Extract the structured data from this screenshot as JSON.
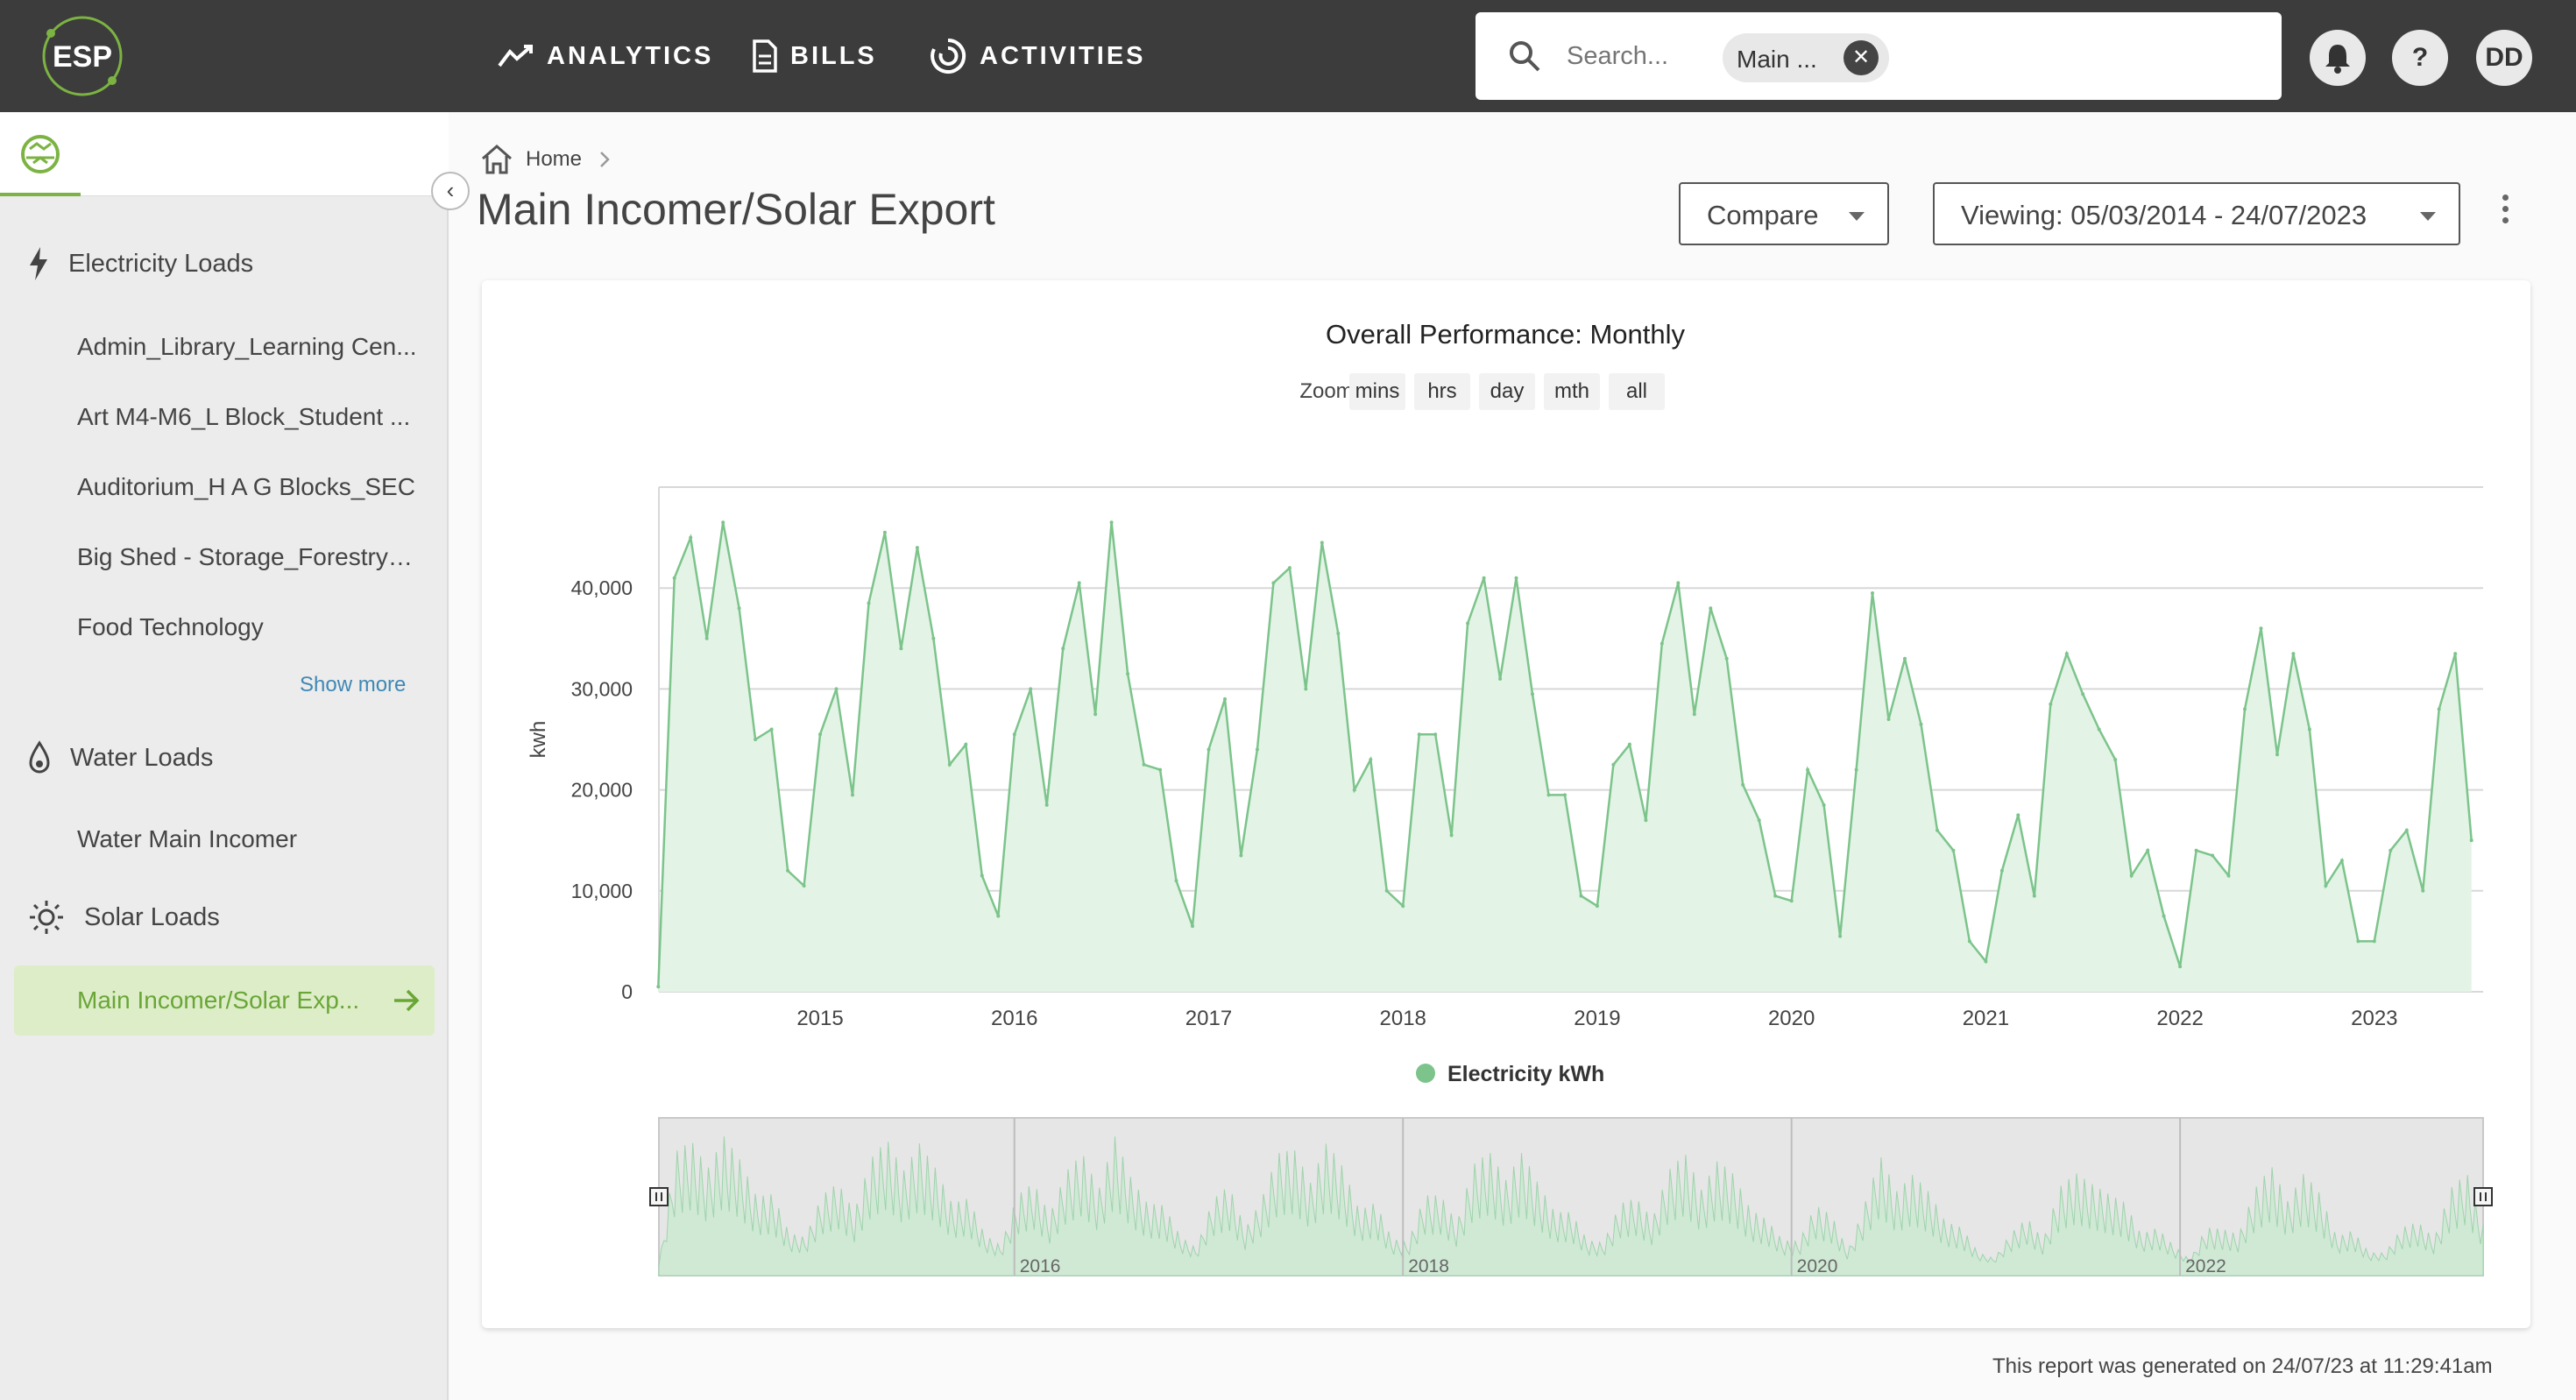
{
  "app": {
    "logo_text": "ESP"
  },
  "nav": {
    "analytics": "ANALYTICS",
    "bills": "BILLS",
    "activities": "ACTIVITIES"
  },
  "search": {
    "placeholder": "Search...",
    "chip_label": "Main ..."
  },
  "user": {
    "help": "?",
    "initials": "DD"
  },
  "sidebar": {
    "categories": [
      {
        "label": "Electricity Loads",
        "icon": "lightning-icon"
      },
      {
        "label": "Water Loads",
        "icon": "water-drop-icon"
      },
      {
        "label": "Solar Loads",
        "icon": "solar-icon"
      }
    ],
    "electricity_items": [
      "Admin_Library_Learning Cen...",
      "Art M4-M6_L Block_Student ...",
      "Auditorium_H A G Blocks_SEC",
      "Big Shed - Storage_Forestry_...",
      "Food Technology"
    ],
    "show_more": "Show more",
    "water_items": [
      "Water Main Incomer"
    ],
    "solar_items": [
      "Main Incomer/Solar Exp..."
    ]
  },
  "breadcrumb": {
    "home": "Home"
  },
  "page": {
    "title": "Main Incomer/Solar Export",
    "compare_label": "Compare",
    "viewing_label": "Viewing: 05/03/2014 - 24/07/2023"
  },
  "zoom": {
    "label": "Zoom",
    "options": [
      "mins",
      "hrs",
      "day",
      "mth",
      "all"
    ]
  },
  "colors": {
    "series": "#7cc48b",
    "fill": "#e3f3e6",
    "accent": "#7cb342"
  },
  "chart_data": {
    "type": "area",
    "title": "Overall Performance: Monthly",
    "ylabel": "kwh",
    "ylim": [
      0,
      50000
    ],
    "yticks": [
      0,
      10000,
      20000,
      30000,
      40000
    ],
    "ytick_labels": [
      "0",
      "10,000",
      "20,000",
      "30,000",
      "40,000"
    ],
    "xlim": [
      2014.17,
      2023.56
    ],
    "xticks": [
      "2015",
      "2016",
      "2017",
      "2018",
      "2019",
      "2020",
      "2021",
      "2022",
      "2023"
    ],
    "legend": "bottom-center",
    "grid": true,
    "series": [
      {
        "name": "Electricity kWh",
        "x": [
          "2014-03",
          "2014-04",
          "2014-05",
          "2014-06",
          "2014-07",
          "2014-08",
          "2014-09",
          "2014-10",
          "2014-11",
          "2014-12",
          "2015-01",
          "2015-02",
          "2015-03",
          "2015-04",
          "2015-05",
          "2015-06",
          "2015-07",
          "2015-08",
          "2015-09",
          "2015-10",
          "2015-11",
          "2015-12",
          "2016-01",
          "2016-02",
          "2016-03",
          "2016-04",
          "2016-05",
          "2016-06",
          "2016-07",
          "2016-08",
          "2016-09",
          "2016-10",
          "2016-11",
          "2016-12",
          "2017-01",
          "2017-02",
          "2017-03",
          "2017-04",
          "2017-05",
          "2017-06",
          "2017-07",
          "2017-08",
          "2017-09",
          "2017-10",
          "2017-11",
          "2017-12",
          "2018-01",
          "2018-02",
          "2018-03",
          "2018-04",
          "2018-05",
          "2018-06",
          "2018-07",
          "2018-08",
          "2018-09",
          "2018-10",
          "2018-11",
          "2018-12",
          "2019-01",
          "2019-02",
          "2019-03",
          "2019-04",
          "2019-05",
          "2019-06",
          "2019-07",
          "2019-08",
          "2019-09",
          "2019-10",
          "2019-11",
          "2019-12",
          "2020-01",
          "2020-02",
          "2020-03",
          "2020-04",
          "2020-05",
          "2020-06",
          "2020-07",
          "2020-08",
          "2020-09",
          "2020-10",
          "2020-11",
          "2020-12",
          "2021-01",
          "2021-02",
          "2021-03",
          "2021-04",
          "2021-05",
          "2021-06",
          "2021-07",
          "2021-08",
          "2021-09",
          "2021-10",
          "2021-11",
          "2021-12",
          "2022-01",
          "2022-02",
          "2022-03",
          "2022-04",
          "2022-05",
          "2022-06",
          "2022-07",
          "2022-08",
          "2022-09",
          "2022-10",
          "2022-11",
          "2022-12",
          "2023-01",
          "2023-02",
          "2023-03",
          "2023-04",
          "2023-05",
          "2023-06",
          "2023-07"
        ],
        "values": [
          500,
          41000,
          45000,
          35000,
          46500,
          38000,
          25000,
          26000,
          12000,
          10500,
          25500,
          30000,
          19500,
          38500,
          45500,
          34000,
          44000,
          35000,
          22500,
          24500,
          11500,
          7500,
          25500,
          30000,
          18500,
          34000,
          40500,
          27500,
          46500,
          31500,
          22500,
          22000,
          11000,
          6500,
          24000,
          29000,
          13500,
          24000,
          40500,
          42000,
          30000,
          44500,
          35500,
          20000,
          23000,
          10000,
          8500,
          25500,
          25500,
          15500,
          36500,
          41000,
          31000,
          41000,
          29500,
          19500,
          19500,
          9500,
          8500,
          22500,
          24500,
          17000,
          34500,
          40500,
          27500,
          38000,
          33000,
          20500,
          17000,
          9500,
          9000,
          22000,
          18500,
          5500,
          22000,
          39500,
          27000,
          33000,
          26500,
          16000,
          14000,
          5000,
          3000,
          12000,
          17500,
          9500,
          28500,
          33500,
          29500,
          26000,
          23000,
          11500,
          14000,
          7500,
          2500,
          14000,
          13500,
          11500,
          28000,
          36000,
          23500,
          33500,
          26000,
          10500,
          13000,
          5000,
          5000,
          14000,
          16000,
          10000,
          28000,
          33500,
          15000
        ]
      }
    ],
    "navigator": {
      "labels": [
        "2016",
        "2018",
        "2020",
        "2022"
      ]
    }
  },
  "footer": {
    "note": "This report was generated on 24/07/23 at 11:29:41am"
  }
}
